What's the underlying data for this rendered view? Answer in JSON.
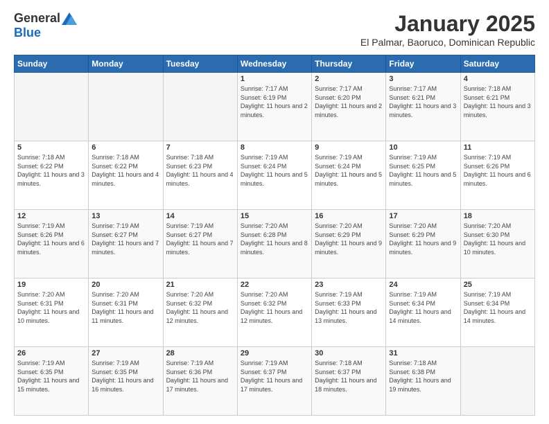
{
  "logo": {
    "general": "General",
    "blue": "Blue"
  },
  "header": {
    "title": "January 2025",
    "subtitle": "El Palmar, Baoruco, Dominican Republic"
  },
  "weekdays": [
    "Sunday",
    "Monday",
    "Tuesday",
    "Wednesday",
    "Thursday",
    "Friday",
    "Saturday"
  ],
  "weeks": [
    [
      {
        "day": "",
        "info": ""
      },
      {
        "day": "",
        "info": ""
      },
      {
        "day": "",
        "info": ""
      },
      {
        "day": "1",
        "info": "Sunrise: 7:17 AM\nSunset: 6:19 PM\nDaylight: 11 hours and 2 minutes."
      },
      {
        "day": "2",
        "info": "Sunrise: 7:17 AM\nSunset: 6:20 PM\nDaylight: 11 hours and 2 minutes."
      },
      {
        "day": "3",
        "info": "Sunrise: 7:17 AM\nSunset: 6:21 PM\nDaylight: 11 hours and 3 minutes."
      },
      {
        "day": "4",
        "info": "Sunrise: 7:18 AM\nSunset: 6:21 PM\nDaylight: 11 hours and 3 minutes."
      }
    ],
    [
      {
        "day": "5",
        "info": "Sunrise: 7:18 AM\nSunset: 6:22 PM\nDaylight: 11 hours and 3 minutes."
      },
      {
        "day": "6",
        "info": "Sunrise: 7:18 AM\nSunset: 6:22 PM\nDaylight: 11 hours and 4 minutes."
      },
      {
        "day": "7",
        "info": "Sunrise: 7:18 AM\nSunset: 6:23 PM\nDaylight: 11 hours and 4 minutes."
      },
      {
        "day": "8",
        "info": "Sunrise: 7:19 AM\nSunset: 6:24 PM\nDaylight: 11 hours and 5 minutes."
      },
      {
        "day": "9",
        "info": "Sunrise: 7:19 AM\nSunset: 6:24 PM\nDaylight: 11 hours and 5 minutes."
      },
      {
        "day": "10",
        "info": "Sunrise: 7:19 AM\nSunset: 6:25 PM\nDaylight: 11 hours and 5 minutes."
      },
      {
        "day": "11",
        "info": "Sunrise: 7:19 AM\nSunset: 6:26 PM\nDaylight: 11 hours and 6 minutes."
      }
    ],
    [
      {
        "day": "12",
        "info": "Sunrise: 7:19 AM\nSunset: 6:26 PM\nDaylight: 11 hours and 6 minutes."
      },
      {
        "day": "13",
        "info": "Sunrise: 7:19 AM\nSunset: 6:27 PM\nDaylight: 11 hours and 7 minutes."
      },
      {
        "day": "14",
        "info": "Sunrise: 7:19 AM\nSunset: 6:27 PM\nDaylight: 11 hours and 7 minutes."
      },
      {
        "day": "15",
        "info": "Sunrise: 7:20 AM\nSunset: 6:28 PM\nDaylight: 11 hours and 8 minutes."
      },
      {
        "day": "16",
        "info": "Sunrise: 7:20 AM\nSunset: 6:29 PM\nDaylight: 11 hours and 9 minutes."
      },
      {
        "day": "17",
        "info": "Sunrise: 7:20 AM\nSunset: 6:29 PM\nDaylight: 11 hours and 9 minutes."
      },
      {
        "day": "18",
        "info": "Sunrise: 7:20 AM\nSunset: 6:30 PM\nDaylight: 11 hours and 10 minutes."
      }
    ],
    [
      {
        "day": "19",
        "info": "Sunrise: 7:20 AM\nSunset: 6:31 PM\nDaylight: 11 hours and 10 minutes."
      },
      {
        "day": "20",
        "info": "Sunrise: 7:20 AM\nSunset: 6:31 PM\nDaylight: 11 hours and 11 minutes."
      },
      {
        "day": "21",
        "info": "Sunrise: 7:20 AM\nSunset: 6:32 PM\nDaylight: 11 hours and 12 minutes."
      },
      {
        "day": "22",
        "info": "Sunrise: 7:20 AM\nSunset: 6:32 PM\nDaylight: 11 hours and 12 minutes."
      },
      {
        "day": "23",
        "info": "Sunrise: 7:19 AM\nSunset: 6:33 PM\nDaylight: 11 hours and 13 minutes."
      },
      {
        "day": "24",
        "info": "Sunrise: 7:19 AM\nSunset: 6:34 PM\nDaylight: 11 hours and 14 minutes."
      },
      {
        "day": "25",
        "info": "Sunrise: 7:19 AM\nSunset: 6:34 PM\nDaylight: 11 hours and 14 minutes."
      }
    ],
    [
      {
        "day": "26",
        "info": "Sunrise: 7:19 AM\nSunset: 6:35 PM\nDaylight: 11 hours and 15 minutes."
      },
      {
        "day": "27",
        "info": "Sunrise: 7:19 AM\nSunset: 6:35 PM\nDaylight: 11 hours and 16 minutes."
      },
      {
        "day": "28",
        "info": "Sunrise: 7:19 AM\nSunset: 6:36 PM\nDaylight: 11 hours and 17 minutes."
      },
      {
        "day": "29",
        "info": "Sunrise: 7:19 AM\nSunset: 6:37 PM\nDaylight: 11 hours and 17 minutes."
      },
      {
        "day": "30",
        "info": "Sunrise: 7:18 AM\nSunset: 6:37 PM\nDaylight: 11 hours and 18 minutes."
      },
      {
        "day": "31",
        "info": "Sunrise: 7:18 AM\nSunset: 6:38 PM\nDaylight: 11 hours and 19 minutes."
      },
      {
        "day": "",
        "info": ""
      }
    ]
  ]
}
